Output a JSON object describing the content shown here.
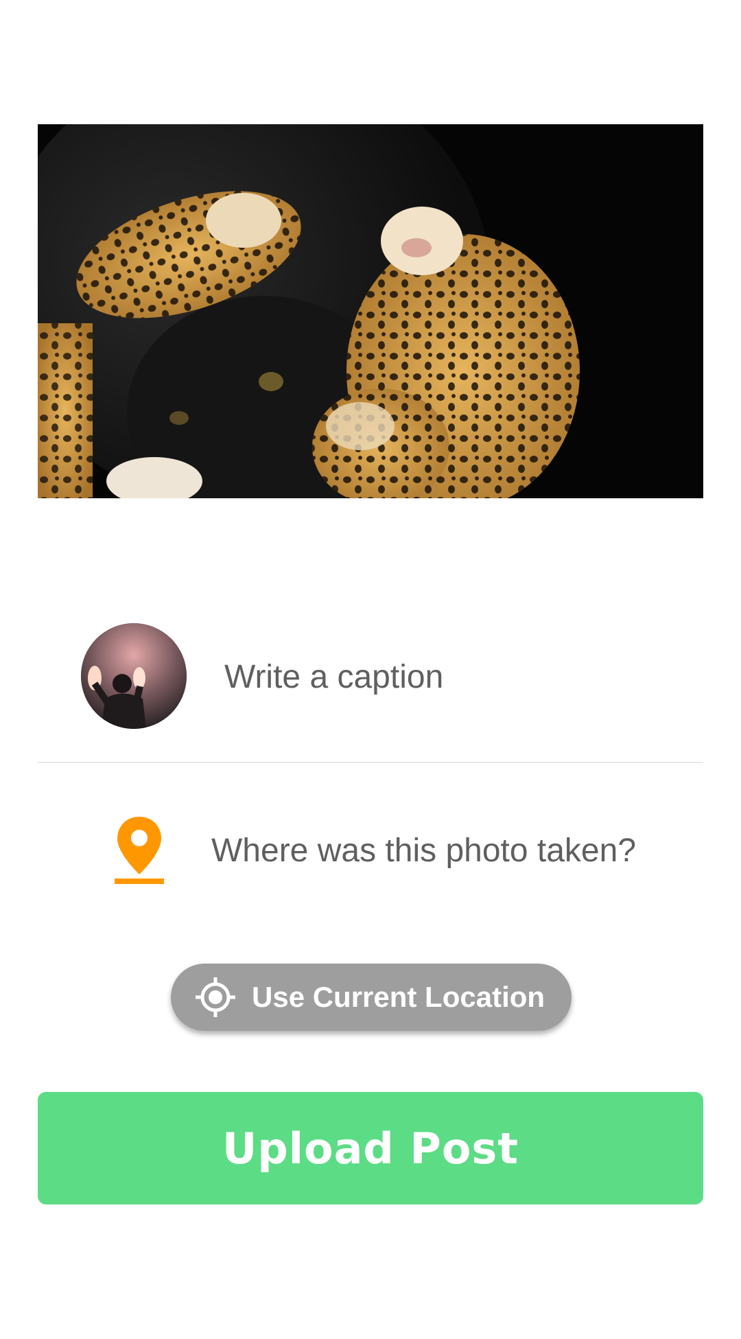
{
  "post": {
    "image_alt": "black panther and jaguar photo"
  },
  "caption": {
    "placeholder": "Write a caption",
    "value": ""
  },
  "location": {
    "icon": "location-pin-icon",
    "placeholder": "Where was this photo taken?",
    "value": ""
  },
  "current_location_button": {
    "icon": "gps-crosshair-icon",
    "label": "Use Current Location"
  },
  "upload_button": {
    "label": "Upload Post"
  },
  "colors": {
    "accent_pin": "#ff9800",
    "upload_green": "#5ddc86",
    "location_button_gray": "#9e9e9e",
    "text_gray": "#5f5f5f"
  }
}
